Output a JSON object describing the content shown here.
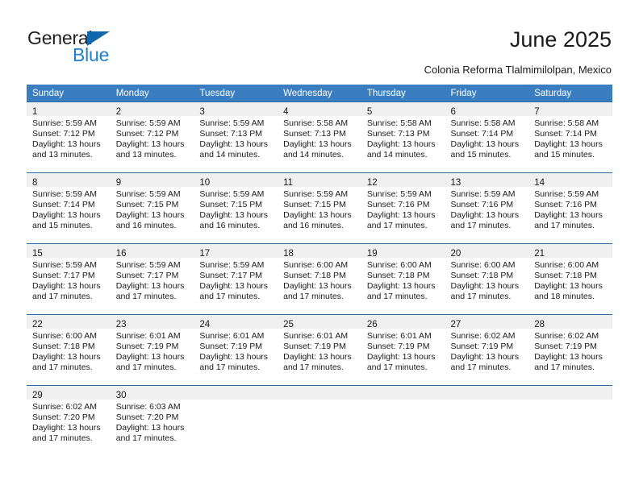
{
  "brand": {
    "name_part1": "General",
    "name_part2": "Blue",
    "triangle_color": "#1266ad",
    "blue_color": "#1f7fd0"
  },
  "header": {
    "title": "June 2025",
    "subtitle": "Colonia Reforma Tlalmimilolpan, Mexico"
  },
  "theme": {
    "header_bg": "#3a7dc0",
    "row_divider": "#2e6da4",
    "daynum_bg": "#efefef"
  },
  "weekday_headers": [
    "Sunday",
    "Monday",
    "Tuesday",
    "Wednesday",
    "Thursday",
    "Friday",
    "Saturday"
  ],
  "weeks": [
    [
      {
        "day": "1",
        "sunrise": "Sunrise: 5:59 AM",
        "sunset": "Sunset: 7:12 PM",
        "daylight": "Daylight: 13 hours and 13 minutes."
      },
      {
        "day": "2",
        "sunrise": "Sunrise: 5:59 AM",
        "sunset": "Sunset: 7:12 PM",
        "daylight": "Daylight: 13 hours and 13 minutes."
      },
      {
        "day": "3",
        "sunrise": "Sunrise: 5:59 AM",
        "sunset": "Sunset: 7:13 PM",
        "daylight": "Daylight: 13 hours and 14 minutes."
      },
      {
        "day": "4",
        "sunrise": "Sunrise: 5:58 AM",
        "sunset": "Sunset: 7:13 PM",
        "daylight": "Daylight: 13 hours and 14 minutes."
      },
      {
        "day": "5",
        "sunrise": "Sunrise: 5:58 AM",
        "sunset": "Sunset: 7:13 PM",
        "daylight": "Daylight: 13 hours and 14 minutes."
      },
      {
        "day": "6",
        "sunrise": "Sunrise: 5:58 AM",
        "sunset": "Sunset: 7:14 PM",
        "daylight": "Daylight: 13 hours and 15 minutes."
      },
      {
        "day": "7",
        "sunrise": "Sunrise: 5:58 AM",
        "sunset": "Sunset: 7:14 PM",
        "daylight": "Daylight: 13 hours and 15 minutes."
      }
    ],
    [
      {
        "day": "8",
        "sunrise": "Sunrise: 5:59 AM",
        "sunset": "Sunset: 7:14 PM",
        "daylight": "Daylight: 13 hours and 15 minutes."
      },
      {
        "day": "9",
        "sunrise": "Sunrise: 5:59 AM",
        "sunset": "Sunset: 7:15 PM",
        "daylight": "Daylight: 13 hours and 16 minutes."
      },
      {
        "day": "10",
        "sunrise": "Sunrise: 5:59 AM",
        "sunset": "Sunset: 7:15 PM",
        "daylight": "Daylight: 13 hours and 16 minutes."
      },
      {
        "day": "11",
        "sunrise": "Sunrise: 5:59 AM",
        "sunset": "Sunset: 7:15 PM",
        "daylight": "Daylight: 13 hours and 16 minutes."
      },
      {
        "day": "12",
        "sunrise": "Sunrise: 5:59 AM",
        "sunset": "Sunset: 7:16 PM",
        "daylight": "Daylight: 13 hours and 17 minutes."
      },
      {
        "day": "13",
        "sunrise": "Sunrise: 5:59 AM",
        "sunset": "Sunset: 7:16 PM",
        "daylight": "Daylight: 13 hours and 17 minutes."
      },
      {
        "day": "14",
        "sunrise": "Sunrise: 5:59 AM",
        "sunset": "Sunset: 7:16 PM",
        "daylight": "Daylight: 13 hours and 17 minutes."
      }
    ],
    [
      {
        "day": "15",
        "sunrise": "Sunrise: 5:59 AM",
        "sunset": "Sunset: 7:17 PM",
        "daylight": "Daylight: 13 hours and 17 minutes."
      },
      {
        "day": "16",
        "sunrise": "Sunrise: 5:59 AM",
        "sunset": "Sunset: 7:17 PM",
        "daylight": "Daylight: 13 hours and 17 minutes."
      },
      {
        "day": "17",
        "sunrise": "Sunrise: 5:59 AM",
        "sunset": "Sunset: 7:17 PM",
        "daylight": "Daylight: 13 hours and 17 minutes."
      },
      {
        "day": "18",
        "sunrise": "Sunrise: 6:00 AM",
        "sunset": "Sunset: 7:18 PM",
        "daylight": "Daylight: 13 hours and 17 minutes."
      },
      {
        "day": "19",
        "sunrise": "Sunrise: 6:00 AM",
        "sunset": "Sunset: 7:18 PM",
        "daylight": "Daylight: 13 hours and 17 minutes."
      },
      {
        "day": "20",
        "sunrise": "Sunrise: 6:00 AM",
        "sunset": "Sunset: 7:18 PM",
        "daylight": "Daylight: 13 hours and 17 minutes."
      },
      {
        "day": "21",
        "sunrise": "Sunrise: 6:00 AM",
        "sunset": "Sunset: 7:18 PM",
        "daylight": "Daylight: 13 hours and 18 minutes."
      }
    ],
    [
      {
        "day": "22",
        "sunrise": "Sunrise: 6:00 AM",
        "sunset": "Sunset: 7:18 PM",
        "daylight": "Daylight: 13 hours and 17 minutes."
      },
      {
        "day": "23",
        "sunrise": "Sunrise: 6:01 AM",
        "sunset": "Sunset: 7:19 PM",
        "daylight": "Daylight: 13 hours and 17 minutes."
      },
      {
        "day": "24",
        "sunrise": "Sunrise: 6:01 AM",
        "sunset": "Sunset: 7:19 PM",
        "daylight": "Daylight: 13 hours and 17 minutes."
      },
      {
        "day": "25",
        "sunrise": "Sunrise: 6:01 AM",
        "sunset": "Sunset: 7:19 PM",
        "daylight": "Daylight: 13 hours and 17 minutes."
      },
      {
        "day": "26",
        "sunrise": "Sunrise: 6:01 AM",
        "sunset": "Sunset: 7:19 PM",
        "daylight": "Daylight: 13 hours and 17 minutes."
      },
      {
        "day": "27",
        "sunrise": "Sunrise: 6:02 AM",
        "sunset": "Sunset: 7:19 PM",
        "daylight": "Daylight: 13 hours and 17 minutes."
      },
      {
        "day": "28",
        "sunrise": "Sunrise: 6:02 AM",
        "sunset": "Sunset: 7:19 PM",
        "daylight": "Daylight: 13 hours and 17 minutes."
      }
    ],
    [
      {
        "day": "29",
        "sunrise": "Sunrise: 6:02 AM",
        "sunset": "Sunset: 7:20 PM",
        "daylight": "Daylight: 13 hours and 17 minutes."
      },
      {
        "day": "30",
        "sunrise": "Sunrise: 6:03 AM",
        "sunset": "Sunset: 7:20 PM",
        "daylight": "Daylight: 13 hours and 17 minutes."
      },
      {
        "day": "",
        "sunrise": "",
        "sunset": "",
        "daylight": ""
      },
      {
        "day": "",
        "sunrise": "",
        "sunset": "",
        "daylight": ""
      },
      {
        "day": "",
        "sunrise": "",
        "sunset": "",
        "daylight": ""
      },
      {
        "day": "",
        "sunrise": "",
        "sunset": "",
        "daylight": ""
      },
      {
        "day": "",
        "sunrise": "",
        "sunset": "",
        "daylight": ""
      }
    ]
  ]
}
